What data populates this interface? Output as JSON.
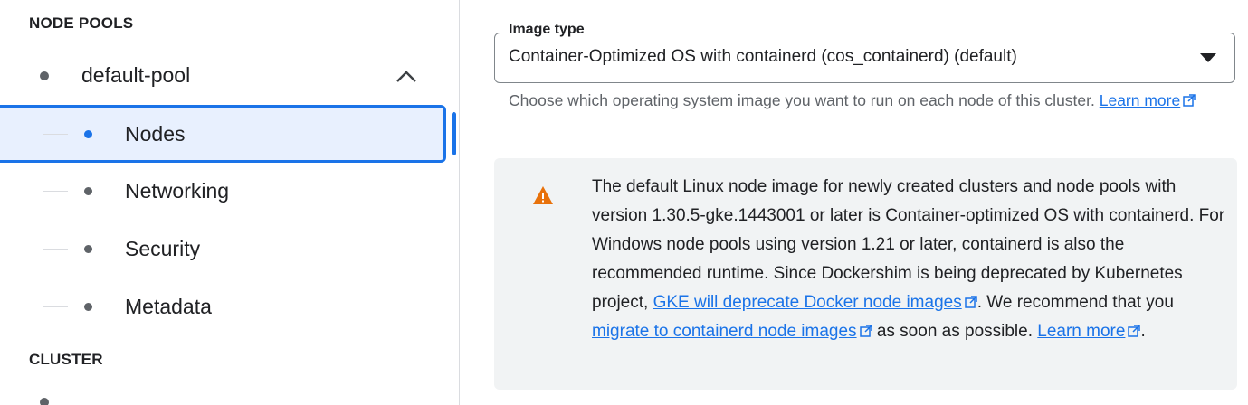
{
  "sidebar": {
    "node_pools_header": "NODE POOLS",
    "pool": {
      "label": "default-pool",
      "expanded": true
    },
    "children": [
      {
        "label": "Nodes",
        "selected": true
      },
      {
        "label": "Networking"
      },
      {
        "label": "Security"
      },
      {
        "label": "Metadata"
      }
    ],
    "cluster_header": "CLUSTER"
  },
  "main": {
    "image_type": {
      "label": "Image type",
      "value": "Container-Optimized OS with containerd (cos_containerd) (default)"
    },
    "helper": {
      "text": "Choose which operating system image you want to run on each node of this cluster. ",
      "link": "Learn more"
    },
    "warning": {
      "part1": "The default Linux node image for newly created clusters and node pools with version 1.30.5-gke.1443001 or later is Container-optimized OS with containerd. For Windows node pools using version 1.21 or later, containerd is also the recommended runtime. Since Dockershim is being deprecated by Kubernetes project, ",
      "link1": "GKE will deprecate Docker node images",
      "part2": ". We recommend that you ",
      "link2": "migrate to containerd node images",
      "part3": " as soon as possible. ",
      "link3": "Learn more",
      "part4": "."
    }
  },
  "colors": {
    "accent": "#1a73e8",
    "selected_bg": "#e8f0fe",
    "warning": "#e8710a",
    "warning_box_bg": "#f1f3f4"
  }
}
